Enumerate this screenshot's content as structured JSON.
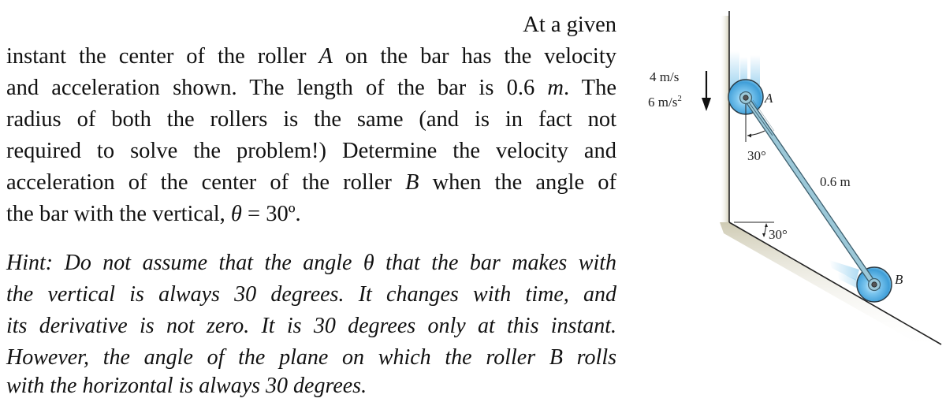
{
  "problem": {
    "lines": [
      {
        "parts": [
          {
            "t": "At a given",
            "s": "text"
          }
        ]
      },
      {
        "parts": [
          {
            "t": "instant the center of the roller ",
            "s": "text"
          },
          {
            "t": "A",
            "s": "math"
          },
          {
            "t": " on the bar has the velocity",
            "s": "text"
          }
        ]
      },
      {
        "parts": [
          {
            "t": "and acceleration shown. The length of the bar is ",
            "s": "text"
          },
          {
            "t": "0.6 ",
            "s": "mathup"
          },
          {
            "t": "m",
            "s": "math"
          },
          {
            "t": ". The",
            "s": "text"
          }
        ]
      },
      {
        "parts": [
          {
            "t": "radius of both the rollers is the same (and is in fact not",
            "s": "text"
          }
        ]
      },
      {
        "parts": [
          {
            "t": "required to solve the problem!) Determine the velocity and",
            "s": "text"
          }
        ]
      },
      {
        "parts": [
          {
            "t": "acceleration of the center of the roller ",
            "s": "text"
          },
          {
            "t": "B",
            "s": "math"
          },
          {
            "t": " when the angle of",
            "s": "text"
          }
        ]
      },
      {
        "parts": [
          {
            "t": "the bar with the vertical, ",
            "s": "text"
          },
          {
            "t": "θ",
            "s": "math"
          },
          {
            "t": " = 30º.",
            "s": "mathup"
          }
        ]
      }
    ]
  },
  "hint": {
    "lines": [
      "Hint: Do not assume that the angle θ that the bar makes with",
      "the vertical is always 30 degrees. It changes with time, and",
      "its derivative is not zero. It is 30 degrees only at this instant.",
      "However, the angle of the plane on which the roller B rolls",
      "with the horizontal is always 30 degrees."
    ]
  },
  "diagram": {
    "velocity_label": "4 m/s",
    "acceleration_label_base": "6 m/s",
    "acceleration_label_exp": "2",
    "roller_a_label": "A",
    "roller_b_label": "B",
    "bar_length_label": "0.6 m",
    "bar_angle_label": "30°",
    "plane_angle_label": "30°",
    "arrow_direction": "down",
    "colors": {
      "bar": "#9cc8d8",
      "bar_edge": "#3d5f6e",
      "roller": "#5fb4e8",
      "wall_shadow": "#d9d6c4",
      "line": "#222222"
    }
  }
}
